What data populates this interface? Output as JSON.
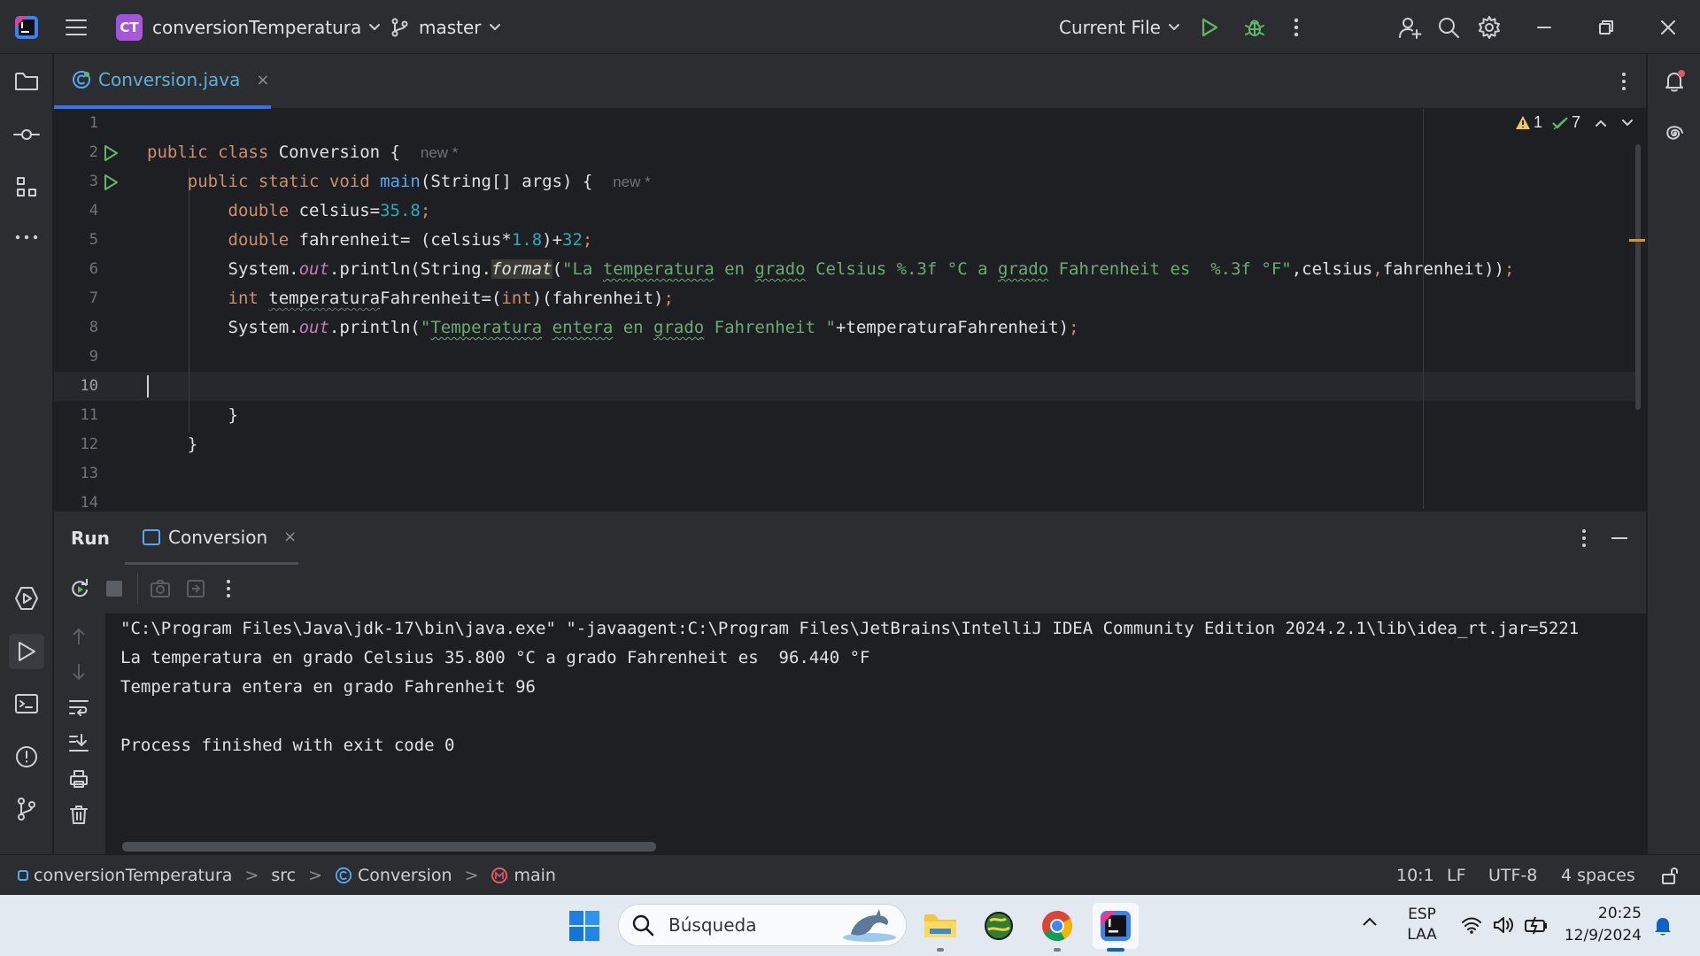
{
  "titlebar": {
    "project_initials": "CT",
    "project_name": "conversionTemperatura",
    "branch": "master",
    "run_config": "Current File"
  },
  "editor_tab": {
    "filename": "Conversion.java",
    "close": "×"
  },
  "inspections": {
    "warnings": "1",
    "ok": "7"
  },
  "editor": {
    "line_numbers": [
      "1",
      "2",
      "3",
      "4",
      "5",
      "6",
      "7",
      "8",
      "9",
      "10",
      "11",
      "12",
      "13",
      "14"
    ],
    "hint_new": "new *"
  },
  "run": {
    "title": "Run",
    "tab": "Conversion",
    "close": "×",
    "console": [
      "\"C:\\Program Files\\Java\\jdk-17\\bin\\java.exe\" \"-javaagent:C:\\Program Files\\JetBrains\\IntelliJ IDEA Community Edition 2024.2.1\\lib\\idea_rt.jar=5221",
      "La temperatura en grado Celsius 35.800 °C a grado Fahrenheit es  96.440 °F",
      "Temperatura entera en grado Fahrenheit 96",
      "",
      "Process finished with exit code 0"
    ]
  },
  "statusbar": {
    "crumbs": [
      "conversionTemperatura",
      "src",
      "Conversion",
      "main"
    ],
    "sep": ">",
    "position": "10:1",
    "line_sep": "LF",
    "encoding": "UTF-8",
    "indent": "4 spaces"
  },
  "taskbar": {
    "search_placeholder": "Búsqueda",
    "lang_top": "ESP",
    "lang_bottom": "LAA",
    "time": "20:25",
    "date": "12/9/2024"
  },
  "colors": {
    "accent": "#3574f0",
    "run_green": "#5fb865",
    "editor_bg": "#1e1f22",
    "panel_bg": "#2b2d30"
  }
}
